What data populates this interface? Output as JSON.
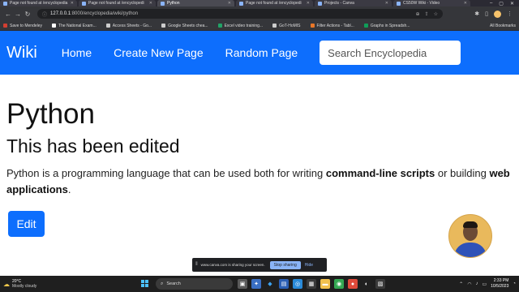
{
  "browser": {
    "tabs": [
      {
        "title": "Page not found at /encyclopedia"
      },
      {
        "title": "Page not found at /encyclopedi"
      },
      {
        "title": "Python"
      },
      {
        "title": "Page not found at /encyclopedi"
      },
      {
        "title": "Projects - Canva"
      },
      {
        "title": "CS50W Wiki - Video"
      }
    ],
    "url_host": "127.0.0.1",
    "url_path": ":8000/encyclopedia/wiki/python",
    "bookmarks": [
      {
        "label": "Save to Mendeley",
        "color": "#d23f31"
      },
      {
        "label": "The National Exam...",
        "color": "#ffffff"
      },
      {
        "label": "Access Sheets - Go...",
        "color": "#cccccc"
      },
      {
        "label": "Google Sheets chea...",
        "color": "#cccccc"
      },
      {
        "label": "Excel video training...",
        "color": "#21a366"
      },
      {
        "label": "GoT-HoMIS",
        "color": "#cccccc"
      },
      {
        "label": "Filter Actions - Tabl...",
        "color": "#e97627"
      },
      {
        "label": "Graphs in Spreadsh...",
        "color": "#0f9d58"
      }
    ],
    "all_bookmarks": "All Bookmarks"
  },
  "site": {
    "brand": "Wiki",
    "nav": {
      "home": "Home",
      "create": "Create New Page",
      "random": "Random Page"
    },
    "search_placeholder": "Search Encyclopedia"
  },
  "article": {
    "title": "Python",
    "subtitle": "This has been edited",
    "body_part1": "Python is a programming language that can be used both for writing ",
    "body_bold1": "command-line scripts",
    "body_part2": " or building ",
    "body_bold2": "web applications",
    "body_part3": ".",
    "edit_label": "Edit"
  },
  "sharebar": {
    "message": "www.canva.com is sharing your screen.",
    "stop_label": "Stop sharing",
    "hide_label": "Hide"
  },
  "taskbar": {
    "temp": "20°C",
    "condition": "Mostly cloudy",
    "search_label": "Search",
    "time": "2:33 PM",
    "date": "10/5/2023"
  },
  "colors": {
    "primary": "#0d6efd",
    "browser_chrome": "#35363a"
  }
}
